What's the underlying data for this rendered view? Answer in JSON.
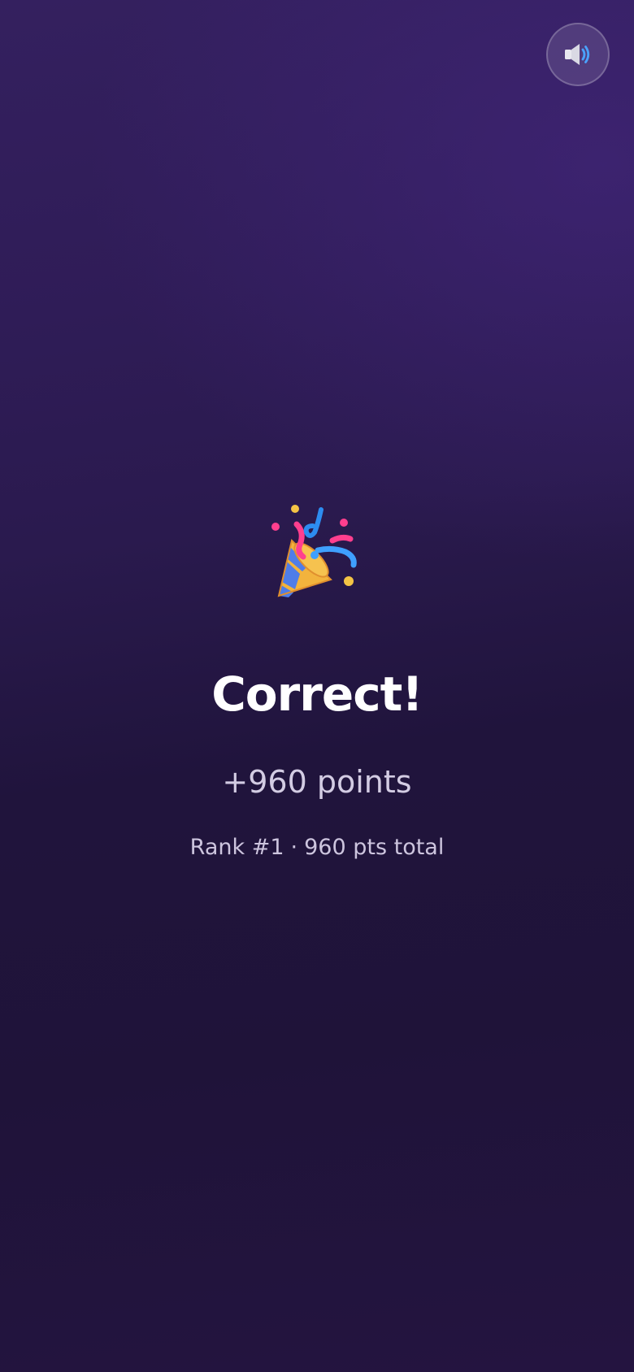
{
  "sound": {
    "icon": "speaker-on-icon",
    "state": "on",
    "colors": {
      "speaker": "#e6e6ee",
      "waves": "#4aa3ff"
    }
  },
  "result": {
    "icon": "party-popper-icon",
    "title": "Correct!",
    "points_gained": "+960 points",
    "rank_label": "Rank #1",
    "separator": "·",
    "total_label": "960 pts total"
  },
  "theme": {
    "background_top": "#34205f",
    "background_bottom": "#1f1339",
    "title_color": "#ffffff",
    "subtext_color": "#d3cce3"
  }
}
